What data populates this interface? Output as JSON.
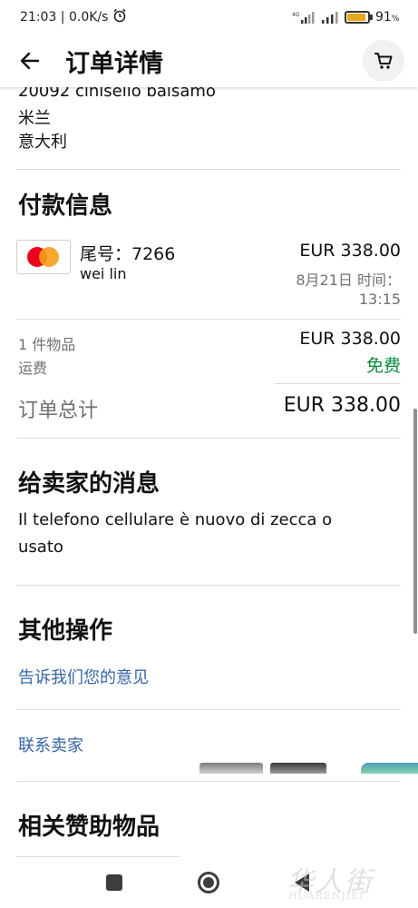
{
  "status_bar": {
    "time": "21:03",
    "speed": "0.0K/s",
    "battery_percent": "91",
    "battery_suffix": "%",
    "battery_level": 0.91
  },
  "app_bar": {
    "title": "订单详情"
  },
  "address": {
    "line1": "20092 cinisello balsamo",
    "line2": "米兰",
    "line3": "意大利"
  },
  "payment": {
    "heading": "付款信息",
    "card_label": "尾号：7266",
    "card_holder": "wei lin",
    "amount": "EUR 338.00",
    "date": "8月21日 时间：",
    "time": "13:15"
  },
  "summary": {
    "items_label": "1 件物品",
    "items_value": "EUR 338.00",
    "shipping_label": "运费",
    "shipping_value": "免费",
    "total_label": "订单总计",
    "total_value": "EUR 338.00"
  },
  "seller_message": {
    "heading": "给卖家的消息",
    "text_line1": "Il telefono cellulare è nuovo di zecca o",
    "text_line2": "usato"
  },
  "other_actions": {
    "heading": "其他操作",
    "feedback_link": "告诉我们您的意见",
    "contact_link": "联系卖家"
  },
  "sponsored": {
    "heading": "相关赞助物品"
  },
  "watermark": {
    "cn": "华人街",
    "en": "HUARENJIEI"
  }
}
